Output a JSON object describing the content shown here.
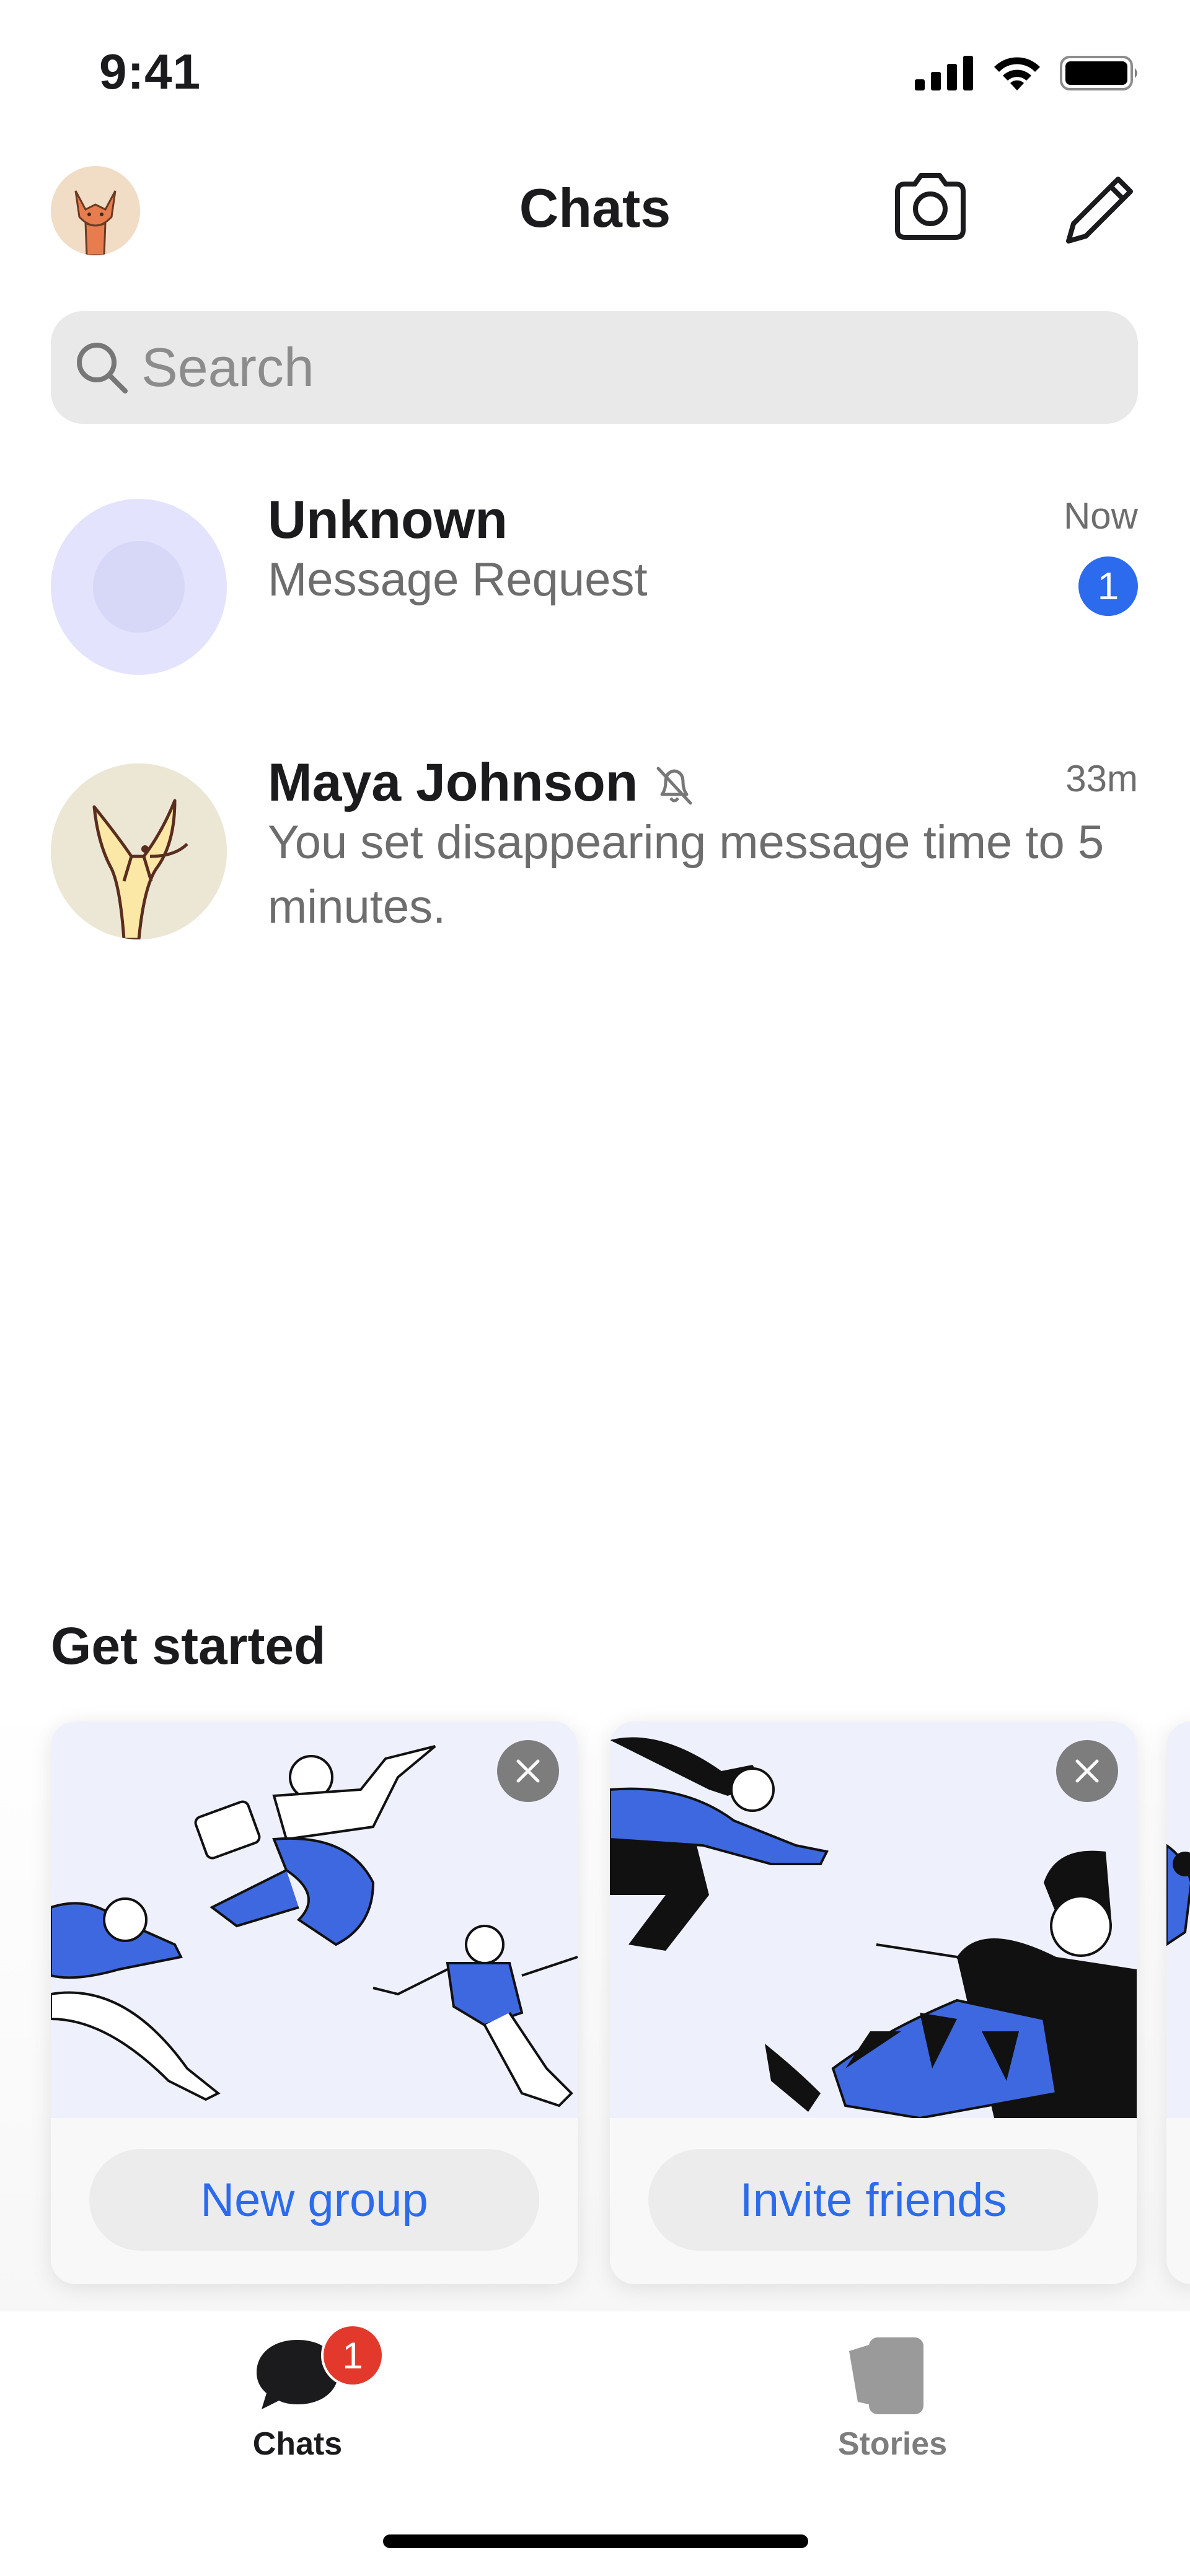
{
  "status_bar": {
    "time": "9:41"
  },
  "header": {
    "title": "Chats"
  },
  "search": {
    "placeholder": "Search"
  },
  "chats": [
    {
      "name": "Unknown",
      "preview": "Message Request",
      "time": "Now",
      "unread": "1",
      "muted": false
    },
    {
      "name": "Maya Johnson",
      "preview": "You set disappearing message time to 5 minutes.",
      "time": "33m",
      "muted": true
    }
  ],
  "get_started": {
    "title": "Get started",
    "cards": [
      {
        "button": "New group"
      },
      {
        "button": "Invite friends"
      }
    ]
  },
  "tabs": [
    {
      "label": "Chats",
      "badge": "1",
      "selected": true
    },
    {
      "label": "Stories",
      "selected": false
    }
  ],
  "colors": {
    "accent": "#2c6bed",
    "badge_red": "#e3392d",
    "unknown_avatar": "#e3e3fe"
  }
}
